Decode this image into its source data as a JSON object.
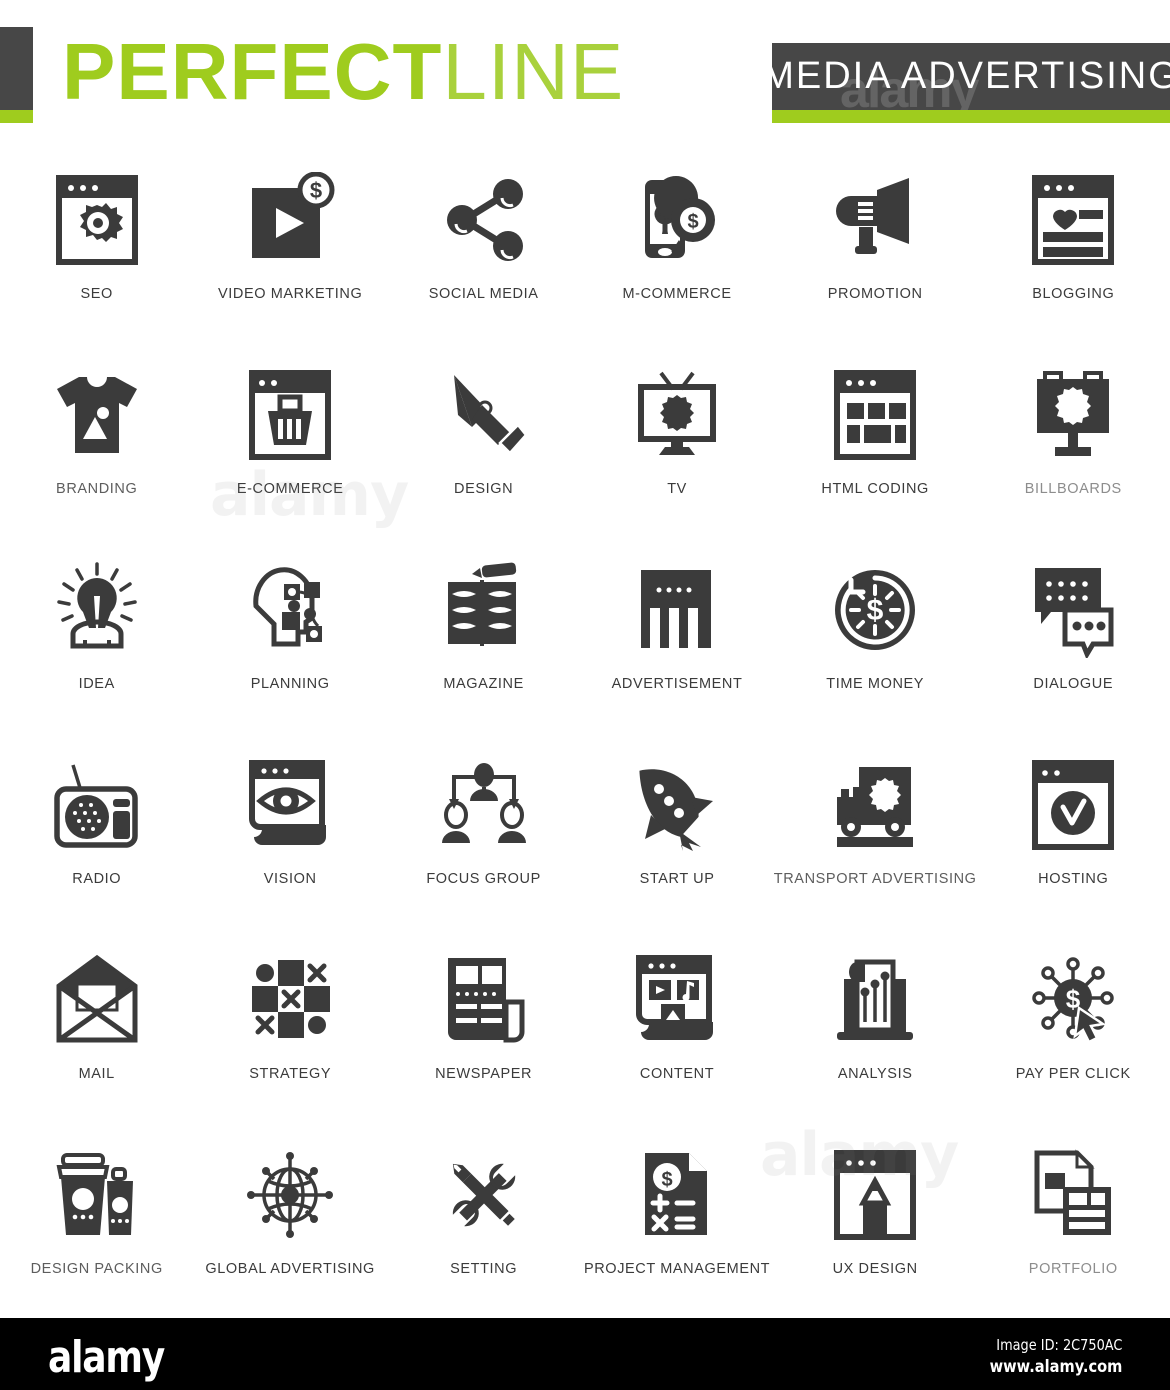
{
  "header": {
    "brand_primary": "PERFECT",
    "brand_secondary": "LINE",
    "category_label": "MEDIA ADVERTISING",
    "watermark": "alamy",
    "accent_color": "#9fcc1e",
    "dark_color": "#474747"
  },
  "footer": {
    "logo": "alamy",
    "image_id": "Image ID: 2C750AC",
    "url": "www.alamy.com",
    "background": "#000000"
  },
  "icons": [
    {
      "label": "SEO",
      "name": "seo-icon",
      "tone": "normal"
    },
    {
      "label": "VIDEO MARKETING",
      "name": "video-marketing-icon",
      "tone": "normal"
    },
    {
      "label": "SOCIAL MEDIA",
      "name": "social-media-icon",
      "tone": "normal"
    },
    {
      "label": "M-COMMERCE",
      "name": "m-commerce-icon",
      "tone": "normal"
    },
    {
      "label": "PROMOTION",
      "name": "promotion-icon",
      "tone": "normal"
    },
    {
      "label": "BLOGGING",
      "name": "blogging-icon",
      "tone": "normal"
    },
    {
      "label": "BRANDING",
      "name": "branding-icon",
      "tone": "half"
    },
    {
      "label": "E-COMMERCE",
      "name": "e-commerce-icon",
      "tone": "normal"
    },
    {
      "label": "DESIGN",
      "name": "design-icon",
      "tone": "normal"
    },
    {
      "label": "TV",
      "name": "tv-icon",
      "tone": "normal"
    },
    {
      "label": "HTML CODING",
      "name": "html-coding-icon",
      "tone": "normal"
    },
    {
      "label": "BILLBOARDS",
      "name": "billboards-icon",
      "tone": "faded"
    },
    {
      "label": "IDEA",
      "name": "idea-icon",
      "tone": "normal"
    },
    {
      "label": "PLANNING",
      "name": "planning-icon",
      "tone": "normal"
    },
    {
      "label": "MAGAZINE",
      "name": "magazine-icon",
      "tone": "normal"
    },
    {
      "label": "ADVERTISEMENT",
      "name": "advertisement-icon",
      "tone": "normal"
    },
    {
      "label": "TIME MONEY",
      "name": "time-money-icon",
      "tone": "normal"
    },
    {
      "label": "DIALOGUE",
      "name": "dialogue-icon",
      "tone": "normal"
    },
    {
      "label": "RADIO",
      "name": "radio-icon",
      "tone": "normal"
    },
    {
      "label": "VISION",
      "name": "vision-icon",
      "tone": "normal"
    },
    {
      "label": "FOCUS GROUP",
      "name": "focus-group-icon",
      "tone": "normal"
    },
    {
      "label": "START UP",
      "name": "start-up-icon",
      "tone": "normal"
    },
    {
      "label": "TRANSPORT ADVERTISING",
      "name": "transport-advertising-icon",
      "tone": "half"
    },
    {
      "label": "HOSTING",
      "name": "hosting-icon",
      "tone": "normal"
    },
    {
      "label": "MAIL",
      "name": "mail-icon",
      "tone": "normal"
    },
    {
      "label": "STRATEGY",
      "name": "strategy-icon",
      "tone": "normal"
    },
    {
      "label": "NEWSPAPER",
      "name": "newspaper-icon",
      "tone": "normal"
    },
    {
      "label": "CONTENT",
      "name": "content-icon",
      "tone": "normal"
    },
    {
      "label": "ANALYSIS",
      "name": "analysis-icon",
      "tone": "normal"
    },
    {
      "label": "PAY PER CLICK",
      "name": "pay-per-click-icon",
      "tone": "normal"
    },
    {
      "label": "DESIGN PACKING",
      "name": "design-packing-icon",
      "tone": "half"
    },
    {
      "label": "GLOBAL ADVERTISING",
      "name": "global-advertising-icon",
      "tone": "normal"
    },
    {
      "label": "SETTING",
      "name": "setting-icon",
      "tone": "normal"
    },
    {
      "label": "PROJECT MANAGEMENT",
      "name": "project-management-icon",
      "tone": "normal"
    },
    {
      "label": "UX DESIGN",
      "name": "ux-design-icon",
      "tone": "normal"
    },
    {
      "label": "PORTFOLIO",
      "name": "portfolio-icon",
      "tone": "faded"
    }
  ]
}
